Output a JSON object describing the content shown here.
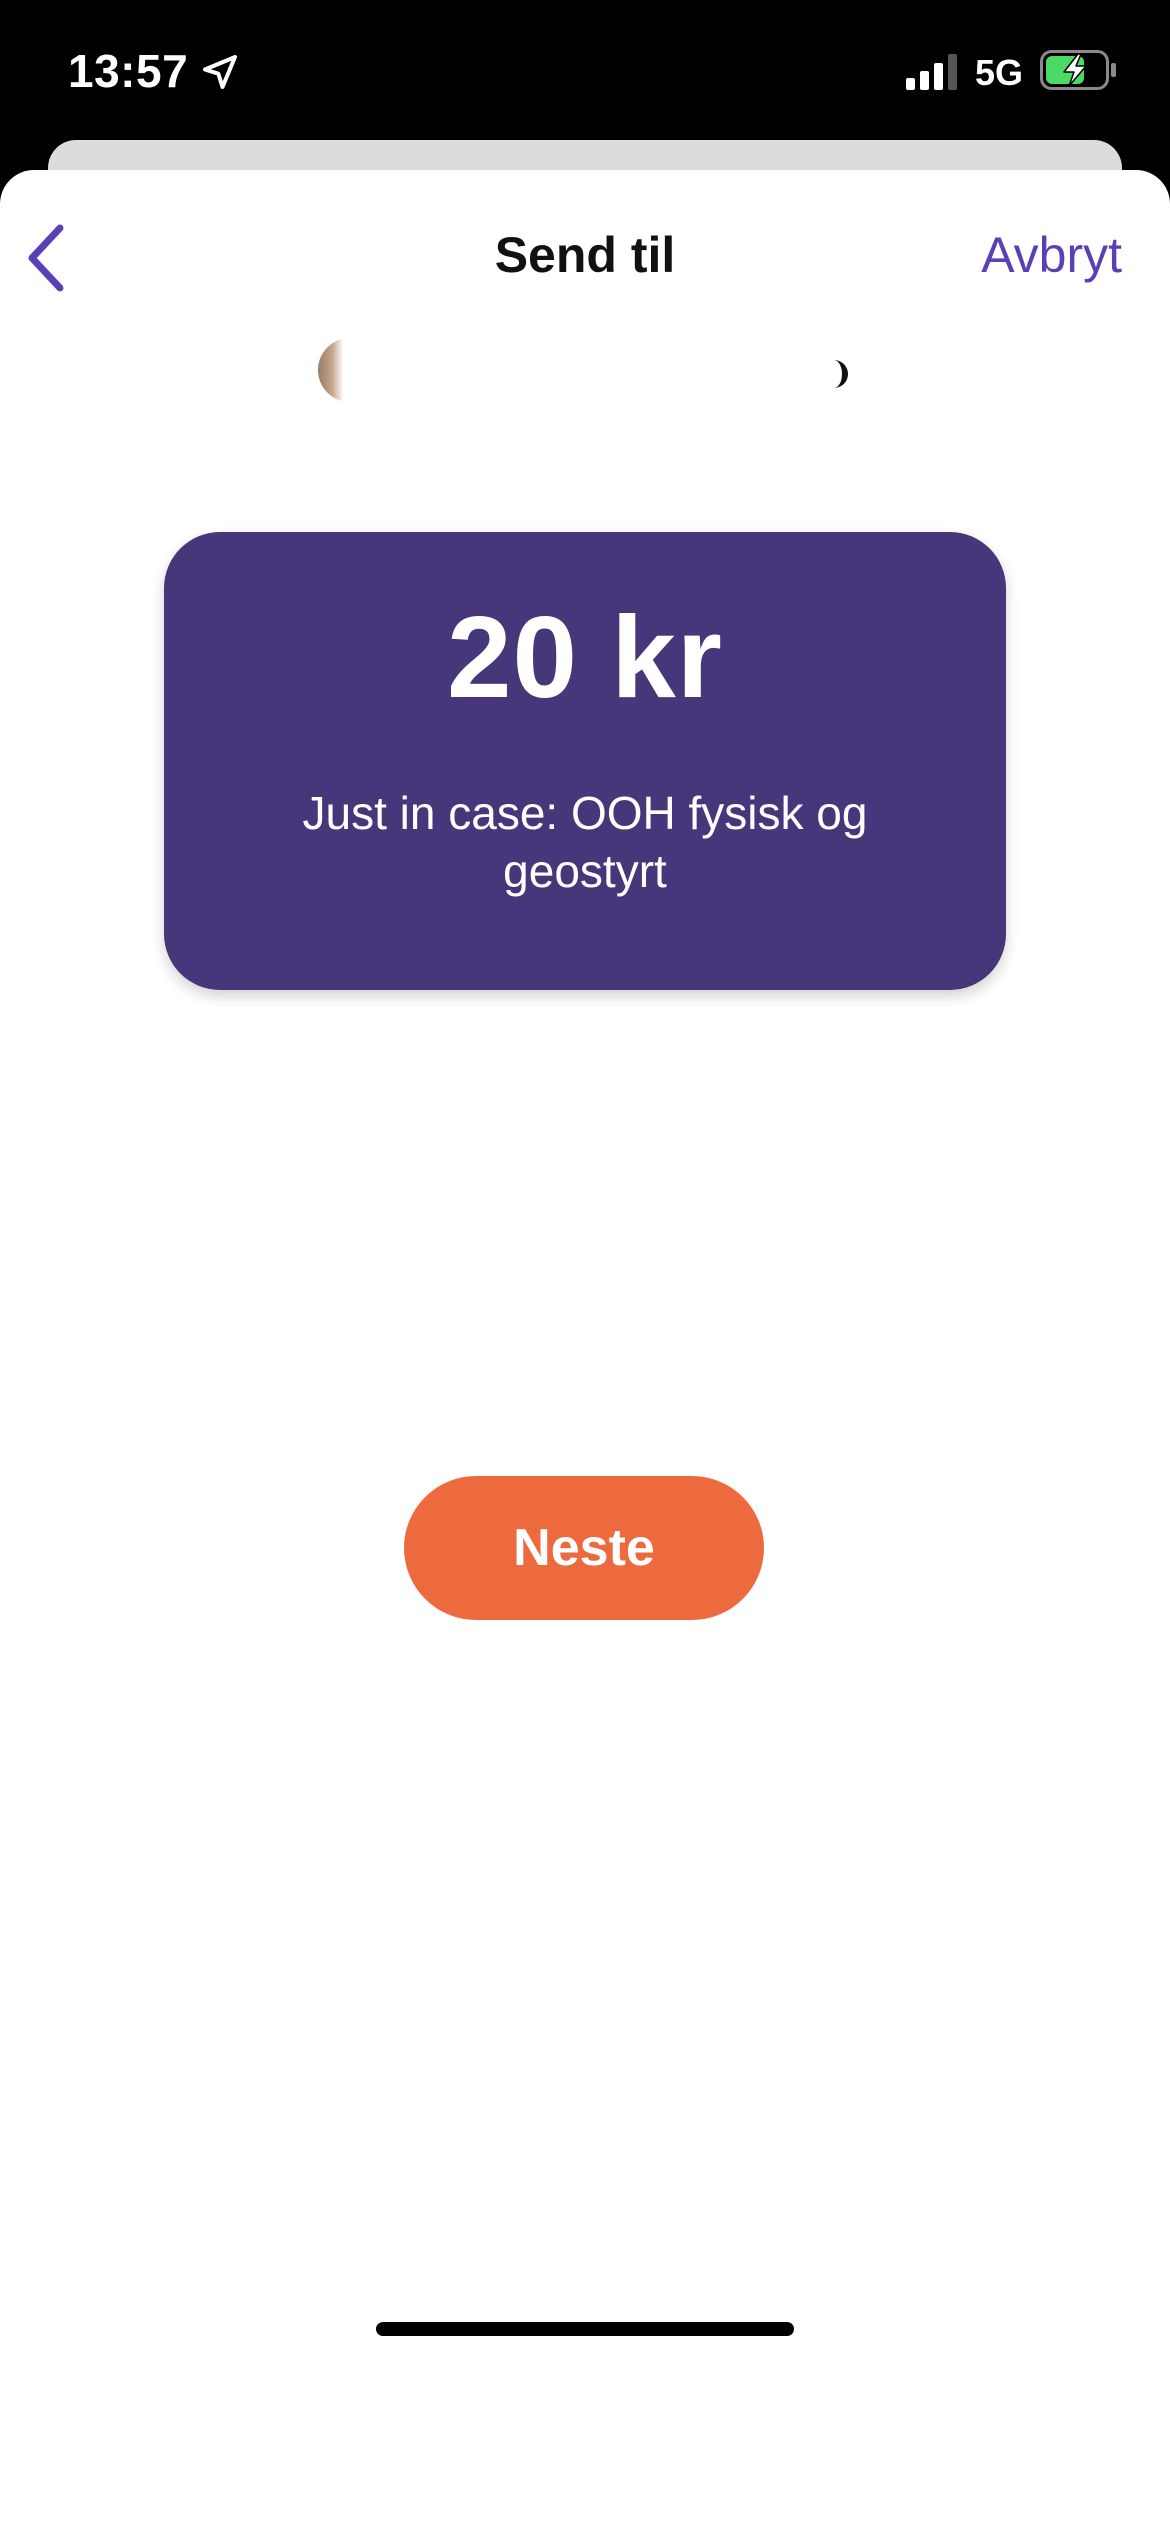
{
  "status_bar": {
    "time": "13:57",
    "network": "5G",
    "icons": [
      "location-arrow-icon",
      "signal-icon",
      "battery-charging-icon"
    ]
  },
  "nav": {
    "title": "Send til",
    "cancel_label": "Avbryt",
    "back_icon": "chevron-left-icon"
  },
  "amount_card": {
    "amount": "20 kr",
    "message": "Just in case: OOH fysisk og geostyrt"
  },
  "actions": {
    "next_label": "Neste"
  },
  "colors": {
    "accent": "#5a3fb5",
    "card": "#47377a",
    "button": "#ec6a3d",
    "battery": "#4cd964"
  }
}
